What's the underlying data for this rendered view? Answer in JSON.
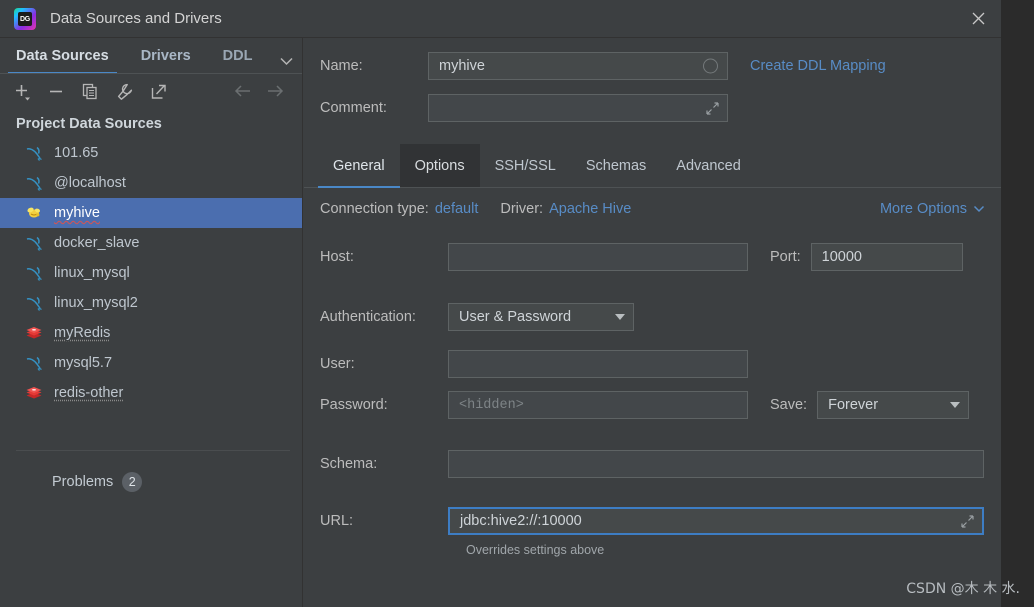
{
  "window": {
    "title": "Data Sources and Drivers",
    "logo_text": "DG",
    "close_icon": "close-icon"
  },
  "sidebar": {
    "tabs": [
      {
        "label": "Data Sources",
        "active": true
      },
      {
        "label": "Drivers",
        "active": false
      },
      {
        "label": "DDL",
        "active": false,
        "clipped": true
      }
    ],
    "tabs_overflow_icon": "chevron-down-icon",
    "toolbar": [
      {
        "name": "add-icon",
        "glyph": "plus"
      },
      {
        "name": "remove-icon",
        "glyph": "minus"
      },
      {
        "name": "copy-icon",
        "glyph": "copy"
      },
      {
        "name": "wrench-icon",
        "glyph": "wrench"
      },
      {
        "name": "share-icon",
        "glyph": "external-link"
      }
    ],
    "nav": [
      {
        "name": "back-arrow-icon",
        "glyph": "arrow-left"
      },
      {
        "name": "forward-arrow-icon",
        "glyph": "arrow-right"
      }
    ],
    "group_title": "Project Data Sources",
    "items": [
      {
        "label": "101.65",
        "icon": "mysql-dolphin-icon",
        "selected": false,
        "underline": "none"
      },
      {
        "label": "@localhost",
        "icon": "mysql-dolphin-icon",
        "selected": false,
        "underline": "none"
      },
      {
        "label": "myhive",
        "icon": "hive-bee-icon",
        "selected": true,
        "underline": "wavy"
      },
      {
        "label": "docker_slave",
        "icon": "mysql-dolphin-icon",
        "selected": false,
        "underline": "none"
      },
      {
        "label": "linux_mysql",
        "icon": "mysql-dolphin-icon",
        "selected": false,
        "underline": "none"
      },
      {
        "label": "linux_mysql2",
        "icon": "mysql-dolphin-icon",
        "selected": false,
        "underline": "none"
      },
      {
        "label": "myRedis",
        "icon": "redis-stack-icon",
        "selected": false,
        "underline": "dotted"
      },
      {
        "label": "mysql5.7",
        "icon": "mysql-dolphin-icon",
        "selected": false,
        "underline": "none"
      },
      {
        "label": "redis-other",
        "icon": "redis-stack-icon",
        "selected": false,
        "underline": "dotted"
      }
    ],
    "problems_label": "Problems",
    "problems_count": "2"
  },
  "main": {
    "name_label": "Name:",
    "name_value": "myhive",
    "name_field_icon": "circle-icon",
    "create_ddl_mapping": "Create DDL Mapping",
    "comment_label": "Comment:",
    "comment_value": "",
    "comment_expand_icon": "expand-icon",
    "tabs": [
      {
        "label": "General",
        "state": "active"
      },
      {
        "label": "Options",
        "state": "hover"
      },
      {
        "label": "SSH/SSL",
        "state": "normal"
      },
      {
        "label": "Schemas",
        "state": "normal"
      },
      {
        "label": "Advanced",
        "state": "normal"
      }
    ],
    "connection_type_label": "Connection type:",
    "connection_type_value": "default",
    "driver_label": "Driver:",
    "driver_value": "Apache Hive",
    "more_options": "More Options",
    "more_options_icon": "chevron-down-icon",
    "host_label": "Host:",
    "host_value": "",
    "port_label": "Port:",
    "port_value": "10000",
    "auth_label": "Authentication:",
    "auth_value": "User & Password",
    "user_label": "User:",
    "user_value": "",
    "password_label": "Password:",
    "password_placeholder": "<hidden>",
    "save_label": "Save:",
    "save_value": "Forever",
    "schema_label": "Schema:",
    "schema_value": "",
    "url_label": "URL:",
    "url_value": "jdbc:hive2://:10000",
    "url_expand_icon": "expand-icon",
    "url_hint": "Overrides settings above"
  },
  "watermark": "CSDN @木 木 水.",
  "colors": {
    "dialog_bg": "#3c3f41",
    "outer_bg": "#2b2b2b",
    "selection_blue": "#4b6eaf",
    "accent_blue": "#4a88c7",
    "link_blue": "#588cc6",
    "focus_border": "#3d7dc4",
    "field_bg": "#45494a",
    "text_primary": "#bfc7cf",
    "error_red": "#d9534f"
  }
}
